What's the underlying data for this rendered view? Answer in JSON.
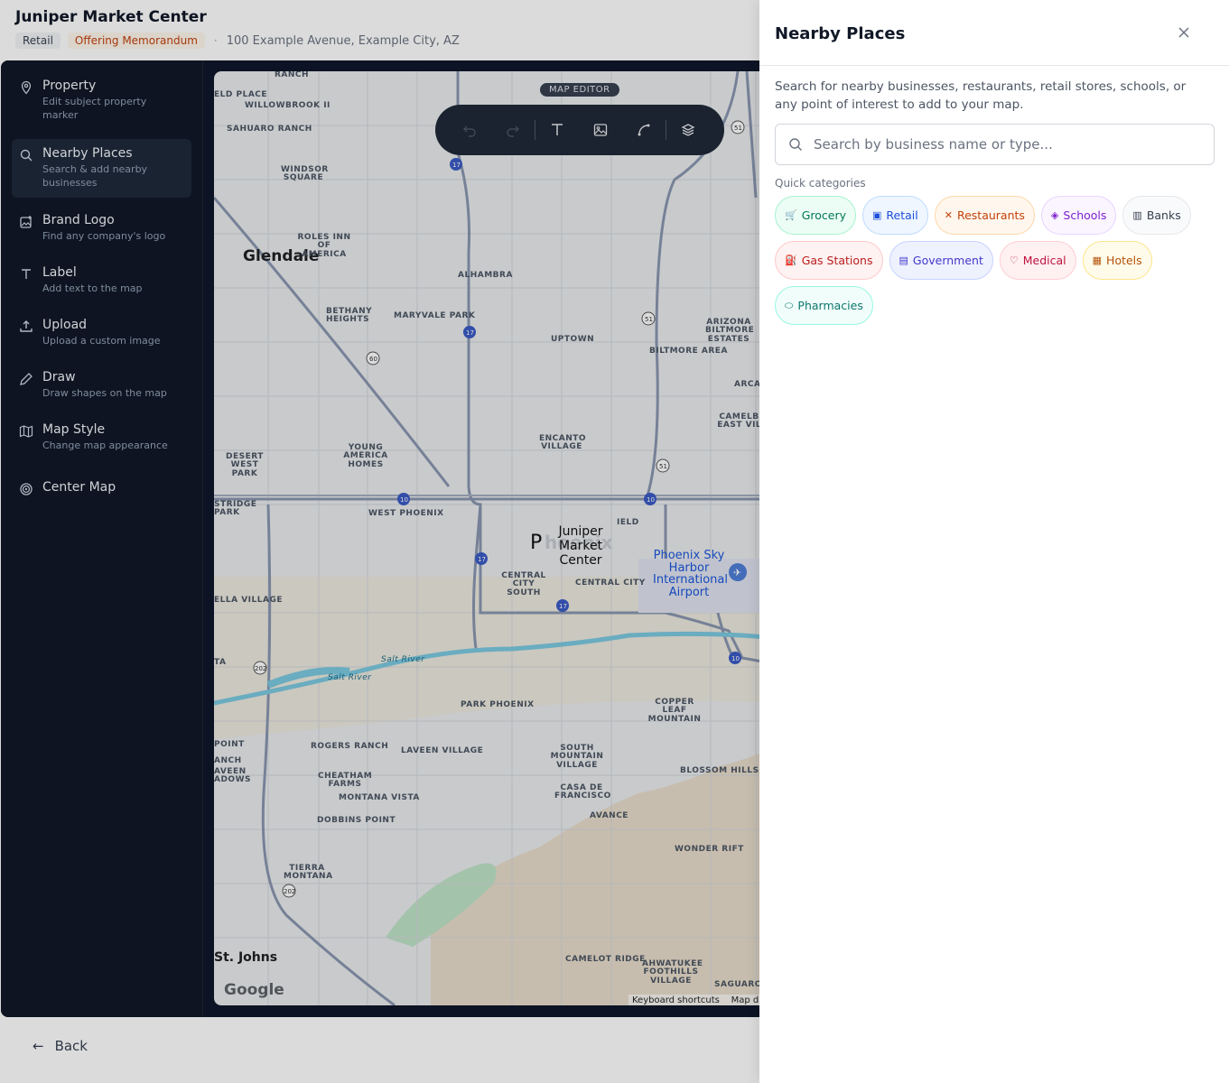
{
  "header": {
    "title": "Juniper Market Center",
    "tag_retail": "Retail",
    "tag_om": "Offering Memorandum",
    "address": "100 Example Avenue, Example City, AZ"
  },
  "sidebar": {
    "items": [
      {
        "title": "Property",
        "sub": "Edit subject property marker"
      },
      {
        "title": "Nearby Places",
        "sub": "Search & add nearby businesses"
      },
      {
        "title": "Brand Logo",
        "sub": "Find any company's logo"
      },
      {
        "title": "Label",
        "sub": "Add text to the map"
      },
      {
        "title": "Upload",
        "sub": "Upload a custom image"
      },
      {
        "title": "Draw",
        "sub": "Draw shapes on the map"
      },
      {
        "title": "Map Style",
        "sub": "Change map appearance"
      },
      {
        "title": "Center Map",
        "sub": ""
      }
    ]
  },
  "map": {
    "editor_badge": "MAP EDITOR",
    "property_label": "Juniper Market Center",
    "google": "Google",
    "attribution_shortcuts": "Keyboard shortcuts",
    "attribution_data": "Map data",
    "labels": {
      "ranch": "RANCH",
      "eld_place": "ELD PLACE",
      "willowbrook": "WILLOWBROOK II",
      "sahuaro": "SAHUARO RANCH",
      "windsor": "WINDSOR SQUARE",
      "glendale": "Glendale",
      "roles_inn": "ROLES INN OF AMERICA",
      "alhambra": "ALHAMBRA",
      "bethany": "BETHANY HEIGHTS",
      "maryvale": "MARYVALE PARK",
      "uptown": "UPTOWN",
      "arizona_biltmore": "ARIZONA BILTMORE ESTATES",
      "biltmore_area": "BILTMORE AREA",
      "arca": "ARCA",
      "camelback": "CAMELBACK EAST VILLAG",
      "encanto": "ENCANTO VILLAGE",
      "desert_west": "DESERT WEST PARK",
      "young_america": "YOUNG AMERICA HOMES",
      "stridge": "STRIDGE PARK",
      "west_phoenix": "WEST PHOENIX",
      "ield": "IELD",
      "central_city_south": "CENTRAL CITY SOUTH",
      "central_city": "CENTRAL CITY",
      "ella_village": "ELLA VILLAGE",
      "airport": "Phoenix Sky Harbor International Airport",
      "ta": "TA",
      "salt_river": "Salt River",
      "salt_river2": "Salt River",
      "park_phoenix": "PARK PHOENIX",
      "copper_leaf": "COPPER LEAF MOUNTAIN",
      "point": "POINT",
      "anch": "ANCH",
      "aveen": "AVEEN ADOWS",
      "rogers_ranch": "ROGERS RANCH",
      "laveen_village": "LAVEEN VILLAGE",
      "south_mountain": "SOUTH MOUNTAIN VILLAGE",
      "blossom": "BLOSSOM HILLS",
      "cheatham": "CHEATHAM FARMS",
      "montana_vista": "MONTANA VISTA",
      "casa_de_francisco": "CASA DE FRANCISCO",
      "dobbins": "DOBBINS POINT",
      "avance": "AVANCE",
      "wonder_rift": "WONDER RIFT",
      "tierra": "TIERRA MONTANA",
      "st_johns": "St. Johns",
      "camelot": "CAMELOT RIDGE",
      "ahwatukee": "AHWATUKEE FOOTHILLS VILLAGE",
      "saguaro": "SAGUARO",
      "pin_letter": "P",
      "phx_ghost": "hoenix"
    },
    "shields": [
      "17",
      "51",
      "17",
      "51",
      "60",
      "10",
      "10",
      "17",
      "17",
      "51",
      "202",
      "202",
      "10"
    ]
  },
  "toolbar": {
    "undo": "undo-icon",
    "redo": "redo-icon",
    "text": "text-icon",
    "image": "image-icon",
    "draw": "draw-path-icon",
    "layers": "layers-icon"
  },
  "back": {
    "label": "Back"
  },
  "panel": {
    "title": "Nearby Places",
    "description": "Search for nearby businesses, restaurants, retail stores, schools, or any point of interest to add to your map.",
    "search_placeholder": "Search by business name or type...",
    "quick_label": "Quick categories",
    "categories": [
      {
        "label": "Grocery",
        "icon": "🛒",
        "color": "#047857",
        "bg": "#ecfdf5",
        "border": "#a7f3d0"
      },
      {
        "label": "Retail",
        "icon": "▣",
        "color": "#1d4ed8",
        "bg": "#eff6ff",
        "border": "#bfdbfe"
      },
      {
        "label": "Restaurants",
        "icon": "✕",
        "color": "#c2410c",
        "bg": "#fff7ed",
        "border": "#fed7aa"
      },
      {
        "label": "Schools",
        "icon": "◈",
        "color": "#7e22ce",
        "bg": "#faf5ff",
        "border": "#e9d5ff"
      },
      {
        "label": "Banks",
        "icon": "▥",
        "color": "#374151",
        "bg": "#f9fafb",
        "border": "#e5e7eb"
      },
      {
        "label": "Gas Stations",
        "icon": "⛽",
        "color": "#b91c1c",
        "bg": "#fef2f2",
        "border": "#fecaca"
      },
      {
        "label": "Government",
        "icon": "▤",
        "color": "#4338ca",
        "bg": "#eef2ff",
        "border": "#c7d2fe"
      },
      {
        "label": "Medical",
        "icon": "♡",
        "color": "#be123c",
        "bg": "#fff1f2",
        "border": "#fecdd3"
      },
      {
        "label": "Hotels",
        "icon": "▦",
        "color": "#b45309",
        "bg": "#fffbeb",
        "border": "#fde68a"
      },
      {
        "label": "Pharmacies",
        "icon": "⬭",
        "color": "#0f766e",
        "bg": "#f0fdfa",
        "border": "#99f6e4"
      }
    ]
  }
}
